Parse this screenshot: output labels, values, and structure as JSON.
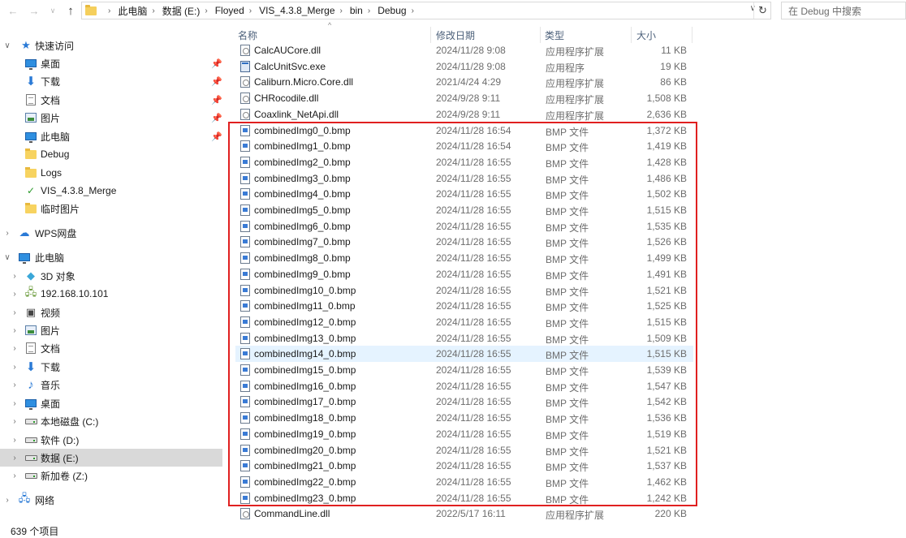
{
  "address": {
    "breadcrumbs": [
      "此电脑",
      "数据 (E:)",
      "Floyed",
      "VIS_4.3.8_Merge",
      "bin",
      "Debug"
    ],
    "search_placeholder": "在 Debug 中搜索"
  },
  "sidebar": {
    "items": [
      {
        "label": "快速访问",
        "icon": "star-icon"
      },
      {
        "label": "桌面",
        "icon": "desktop-icon",
        "pinned": true
      },
      {
        "label": "下载",
        "icon": "download-icon",
        "pinned": true
      },
      {
        "label": "文档",
        "icon": "documents-icon",
        "pinned": true
      },
      {
        "label": "图片",
        "icon": "pictures-icon",
        "pinned": true
      },
      {
        "label": "此电脑",
        "icon": "this-pc-icon",
        "pinned": true
      },
      {
        "label": "Debug",
        "icon": "folder-icon"
      },
      {
        "label": "Logs",
        "icon": "folder-icon"
      },
      {
        "label": "VIS_4.3.8_Merge",
        "icon": "folder-icon"
      },
      {
        "label": "临时图片",
        "icon": "folder-icon"
      },
      {
        "label": "WPS网盘",
        "icon": "cloud-icon"
      },
      {
        "label": "此电脑",
        "icon": "this-pc-icon"
      },
      {
        "label": "3D 对象",
        "icon": "3d-objects-icon"
      },
      {
        "label": "192.168.10.101",
        "icon": "network-drive-icon"
      },
      {
        "label": "视频",
        "icon": "videos-icon"
      },
      {
        "label": "图片",
        "icon": "pictures-icon"
      },
      {
        "label": "文档",
        "icon": "documents-icon"
      },
      {
        "label": "下载",
        "icon": "download-icon"
      },
      {
        "label": "音乐",
        "icon": "music-icon"
      },
      {
        "label": "桌面",
        "icon": "desktop-icon"
      },
      {
        "label": "本地磁盘 (C:)",
        "icon": "drive-icon"
      },
      {
        "label": "软件 (D:)",
        "icon": "drive-icon"
      },
      {
        "label": "数据 (E:)",
        "icon": "drive-icon"
      },
      {
        "label": "新加卷 (Z:)",
        "icon": "network-drive-icon"
      },
      {
        "label": "网络",
        "icon": "network-icon"
      }
    ]
  },
  "columns": {
    "name": "名称",
    "date": "修改日期",
    "type": "类型",
    "size": "大小"
  },
  "files": [
    {
      "name": "CalcAUCore.dll",
      "date": "2024/11/28 9:08",
      "type": "应用程序扩展",
      "size": "11 KB",
      "kind": "dll"
    },
    {
      "name": "CalcUnitSvc.exe",
      "date": "2024/11/28 9:08",
      "type": "应用程序",
      "size": "19 KB",
      "kind": "exe"
    },
    {
      "name": "Caliburn.Micro.Core.dll",
      "date": "2021/4/24 4:29",
      "type": "应用程序扩展",
      "size": "86 KB",
      "kind": "dll"
    },
    {
      "name": "CHRocodile.dll",
      "date": "2024/9/28 9:11",
      "type": "应用程序扩展",
      "size": "1,508 KB",
      "kind": "dll"
    },
    {
      "name": "Coaxlink_NetApi.dll",
      "date": "2024/9/28 9:11",
      "type": "应用程序扩展",
      "size": "2,636 KB",
      "kind": "dll"
    },
    {
      "name": "combinedImg0_0.bmp",
      "date": "2024/11/28 16:54",
      "type": "BMP 文件",
      "size": "1,372 KB",
      "kind": "bmp"
    },
    {
      "name": "combinedImg1_0.bmp",
      "date": "2024/11/28 16:54",
      "type": "BMP 文件",
      "size": "1,419 KB",
      "kind": "bmp"
    },
    {
      "name": "combinedImg2_0.bmp",
      "date": "2024/11/28 16:55",
      "type": "BMP 文件",
      "size": "1,428 KB",
      "kind": "bmp"
    },
    {
      "name": "combinedImg3_0.bmp",
      "date": "2024/11/28 16:55",
      "type": "BMP 文件",
      "size": "1,486 KB",
      "kind": "bmp"
    },
    {
      "name": "combinedImg4_0.bmp",
      "date": "2024/11/28 16:55",
      "type": "BMP 文件",
      "size": "1,502 KB",
      "kind": "bmp"
    },
    {
      "name": "combinedImg5_0.bmp",
      "date": "2024/11/28 16:55",
      "type": "BMP 文件",
      "size": "1,515 KB",
      "kind": "bmp"
    },
    {
      "name": "combinedImg6_0.bmp",
      "date": "2024/11/28 16:55",
      "type": "BMP 文件",
      "size": "1,535 KB",
      "kind": "bmp"
    },
    {
      "name": "combinedImg7_0.bmp",
      "date": "2024/11/28 16:55",
      "type": "BMP 文件",
      "size": "1,526 KB",
      "kind": "bmp"
    },
    {
      "name": "combinedImg8_0.bmp",
      "date": "2024/11/28 16:55",
      "type": "BMP 文件",
      "size": "1,499 KB",
      "kind": "bmp"
    },
    {
      "name": "combinedImg9_0.bmp",
      "date": "2024/11/28 16:55",
      "type": "BMP 文件",
      "size": "1,491 KB",
      "kind": "bmp"
    },
    {
      "name": "combinedImg10_0.bmp",
      "date": "2024/11/28 16:55",
      "type": "BMP 文件",
      "size": "1,521 KB",
      "kind": "bmp"
    },
    {
      "name": "combinedImg11_0.bmp",
      "date": "2024/11/28 16:55",
      "type": "BMP 文件",
      "size": "1,525 KB",
      "kind": "bmp"
    },
    {
      "name": "combinedImg12_0.bmp",
      "date": "2024/11/28 16:55",
      "type": "BMP 文件",
      "size": "1,515 KB",
      "kind": "bmp"
    },
    {
      "name": "combinedImg13_0.bmp",
      "date": "2024/11/28 16:55",
      "type": "BMP 文件",
      "size": "1,509 KB",
      "kind": "bmp"
    },
    {
      "name": "combinedImg14_0.bmp",
      "date": "2024/11/28 16:55",
      "type": "BMP 文件",
      "size": "1,515 KB",
      "kind": "bmp"
    },
    {
      "name": "combinedImg15_0.bmp",
      "date": "2024/11/28 16:55",
      "type": "BMP 文件",
      "size": "1,539 KB",
      "kind": "bmp"
    },
    {
      "name": "combinedImg16_0.bmp",
      "date": "2024/11/28 16:55",
      "type": "BMP 文件",
      "size": "1,547 KB",
      "kind": "bmp"
    },
    {
      "name": "combinedImg17_0.bmp",
      "date": "2024/11/28 16:55",
      "type": "BMP 文件",
      "size": "1,542 KB",
      "kind": "bmp"
    },
    {
      "name": "combinedImg18_0.bmp",
      "date": "2024/11/28 16:55",
      "type": "BMP 文件",
      "size": "1,536 KB",
      "kind": "bmp"
    },
    {
      "name": "combinedImg19_0.bmp",
      "date": "2024/11/28 16:55",
      "type": "BMP 文件",
      "size": "1,519 KB",
      "kind": "bmp"
    },
    {
      "name": "combinedImg20_0.bmp",
      "date": "2024/11/28 16:55",
      "type": "BMP 文件",
      "size": "1,521 KB",
      "kind": "bmp"
    },
    {
      "name": "combinedImg21_0.bmp",
      "date": "2024/11/28 16:55",
      "type": "BMP 文件",
      "size": "1,537 KB",
      "kind": "bmp"
    },
    {
      "name": "combinedImg22_0.bmp",
      "date": "2024/11/28 16:55",
      "type": "BMP 文件",
      "size": "1,462 KB",
      "kind": "bmp"
    },
    {
      "name": "combinedImg23_0.bmp",
      "date": "2024/11/28 16:55",
      "type": "BMP 文件",
      "size": "1,242 KB",
      "kind": "bmp"
    },
    {
      "name": "CommandLine.dll",
      "date": "2022/5/17 16:11",
      "type": "应用程序扩展",
      "size": "220 KB",
      "kind": "dll"
    }
  ],
  "status": {
    "item_count": "639 个项目"
  },
  "colors": {
    "highlight_box": "#e02020",
    "hover_row": "#e5f3ff",
    "selected_nav": "#d9d9d9"
  }
}
